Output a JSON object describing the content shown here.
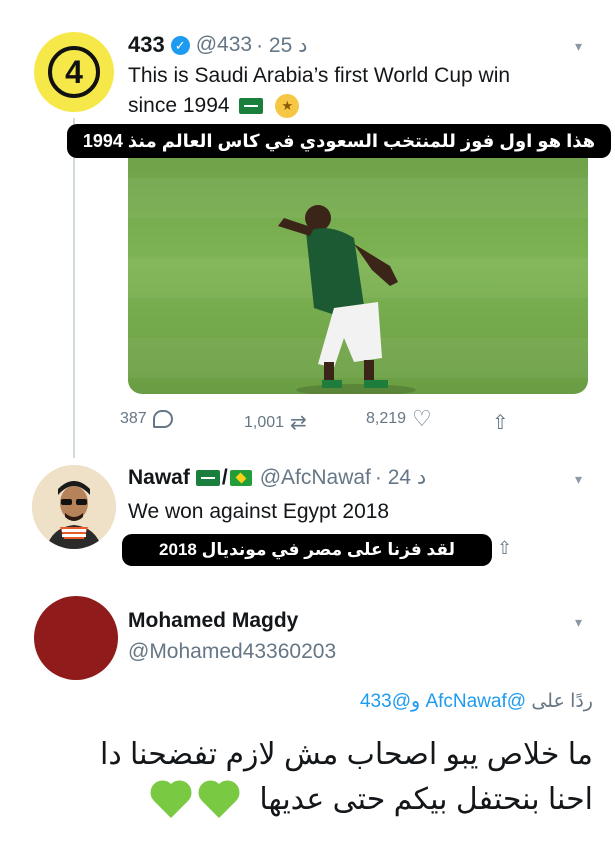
{
  "tweet1": {
    "number_badge": "4",
    "name": "433",
    "handle": "@433",
    "time": "· 25 د",
    "text_line1": "This is Saudi Arabia’s first World Cup win",
    "text_line2": "since 1994",
    "caption": "هذا هو اول فوز للمنتخب السعودي في كاس العالم منذ 1994",
    "replies": "387",
    "retweets": "1,001",
    "likes": "8,219"
  },
  "tweet2": {
    "name": "Nawaf",
    "separator": "/",
    "handle": "@AfcNawaf",
    "time": "· 24 د",
    "text": "We won against Egypt 2018",
    "caption": "لقد فزنا على مصر في مونديال 2018"
  },
  "reply": {
    "name": "Mohamed Magdy",
    "handle": "@Mohamed43360203",
    "replying_prefix": "ردًا على",
    "replying_handles": "@AfcNawaf و@433",
    "line1": "ما خلاص يبو اصحاب مش لازم تفضحنا دا",
    "line2": "احنا بنحتفل بيكم حتى عديها"
  },
  "colors": {
    "link": "#1d9bf0",
    "badge_yellow": "#f7e84a",
    "heart_green": "#7ac943",
    "avatar_red": "#8f1b1b"
  },
  "icons": [
    "reply-icon",
    "retweet-icon",
    "like-icon",
    "share-icon",
    "chevron-down-icon",
    "verified-badge-icon",
    "saudi-flag-icon",
    "brazil-flag-icon",
    "green-heart-icon"
  ]
}
